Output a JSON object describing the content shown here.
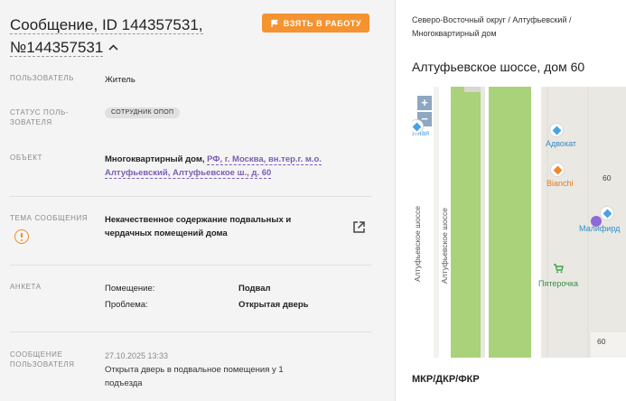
{
  "header": {
    "title_line1": "Сообщение, ID 144357531,",
    "title_line2": "№144357531",
    "take_button": "ВЗЯТЬ В РАБОТУ"
  },
  "fields": {
    "user_label": "ПОЛЬЗОВАТЕЛЬ",
    "user_value": "Житель",
    "status_label_1": "СТАТУС ПОЛЬ-",
    "status_label_2": "ЗОВАТЕЛЯ",
    "status_value": "СОТРУДНИК ОПОП",
    "object_label": "ОБЪЕКТ",
    "object_type": "Многоквартирный дом,",
    "object_address_1": "РФ, г. Москва, вн.тер.г. м.о.",
    "object_address_2": "Алтуфьевский, Алтуфьевское ш., д. 60",
    "topic_label": "ТЕМА СООБЩЕНИЯ",
    "topic_value_1": "Некачественное содержание подвальных и",
    "topic_value_2": "чердачных помещений дома",
    "form_label": "АНКЕТА",
    "form_rows": [
      {
        "key": "Помещение:",
        "value": "Подвал"
      },
      {
        "key": "Проблема:",
        "value": "Открытая дверь"
      }
    ],
    "message_label_1": "СООБЩЕНИЕ",
    "message_label_2": "ПОЛЬЗОВАТЕЛЯ",
    "message_date": "27.10.2025 13:33",
    "message_text_1": "Открыта дверь в подвальное помещения у 1",
    "message_text_2": "подъезда"
  },
  "side": {
    "breadcrumb_1": "Северо-Восточный округ / Алтуфьевский /",
    "breadcrumb_2": "Многоквартирный дом",
    "address_title": "Алтуфьевское шоссе, дом 60",
    "footer_label": "МКР/ДКР/ФКР"
  },
  "map": {
    "zoom_in": "+",
    "zoom_out": "−",
    "partial_label": "ртная",
    "poi_advokat": "Адвокат",
    "poi_bianchi": "Bianchi",
    "poi_malifird": "Малифирд",
    "poi_pyaterochka": "Пятерочка",
    "road_1": "Алтуфьевское шоссе",
    "road_2": "Алтуфьевское шоссе",
    "house_60_a": "60",
    "house_60_b": "60"
  },
  "colors": {
    "accent": "#f59331",
    "link": "#7b5fb3",
    "map_green": "#a9d27a",
    "marker_blue": "#4aa3df",
    "marker_orange": "#f08a2c",
    "marker_purple": "#8d6ad8",
    "shop_green": "#3fa34d"
  }
}
